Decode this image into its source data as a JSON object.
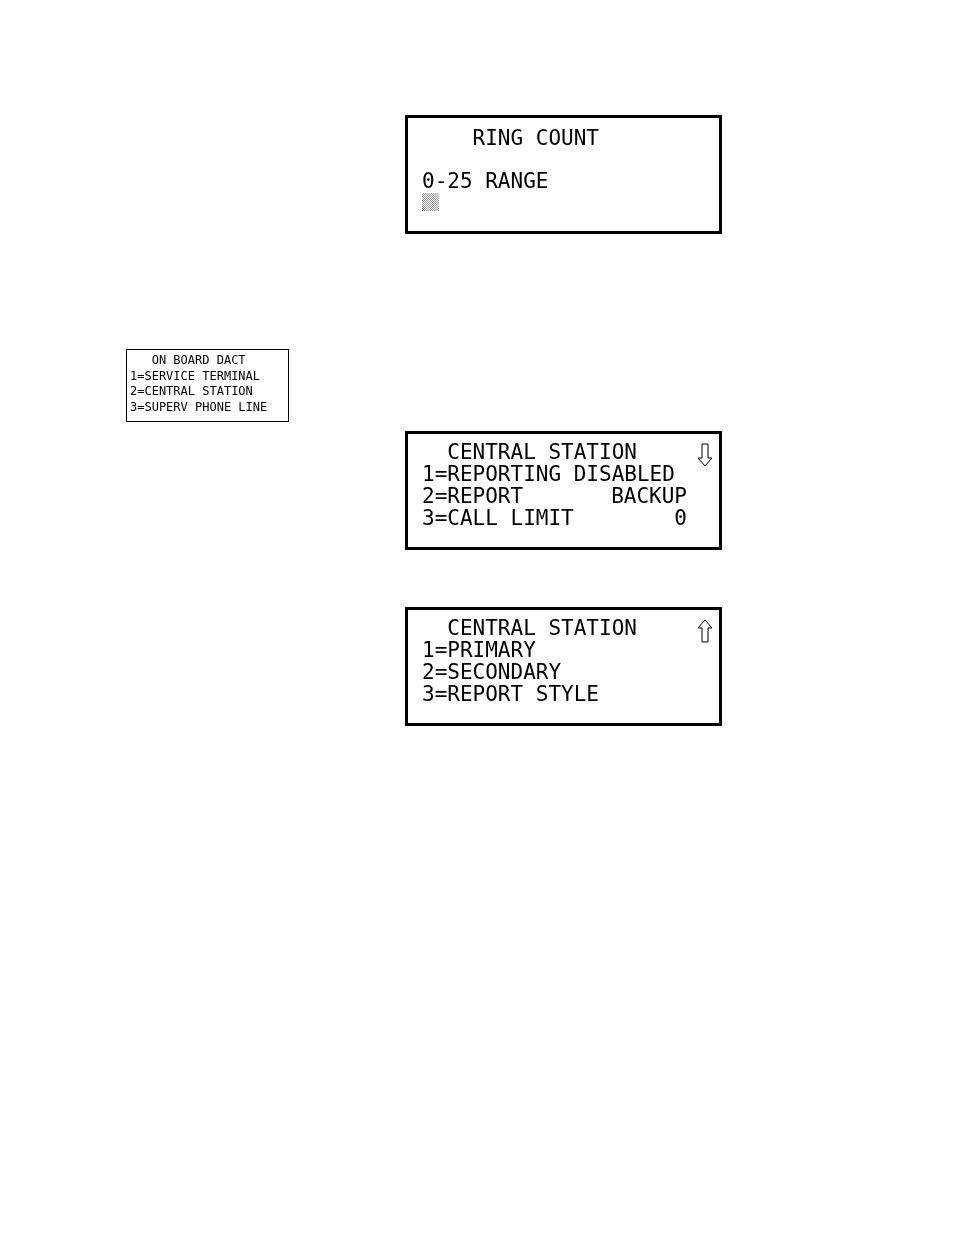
{
  "screens": [
    {
      "kind": "prompt",
      "title": "    RING COUNT",
      "lines": [
        {
          "kind": "text",
          "text": "0-25 RANGE"
        },
        {
          "kind": "entry",
          "cursor": true
        }
      ]
    },
    {
      "kind": "compact",
      "title": "   ON BOARD DACT",
      "lines": [
        {
          "kind": "text",
          "text": "1=SERVICE TERMINAL"
        },
        {
          "kind": "text",
          "text": "2=CENTRAL STATION"
        },
        {
          "kind": "text",
          "text": "3=SUPERV PHONE LINE"
        }
      ]
    },
    {
      "kind": "menu",
      "title": "  CENTRAL STATION",
      "more_below": true,
      "lines": [
        {
          "kind": "text",
          "text": "1=REPORTING DISABLED"
        },
        {
          "kind": "text",
          "text": "2=REPORT",
          "value": "BACKUP"
        },
        {
          "kind": "text",
          "text": "3=CALL LIMIT",
          "value": "0"
        }
      ]
    },
    {
      "kind": "menu",
      "title": "  CENTRAL STATION",
      "more_above": true,
      "lines": [
        {
          "kind": "text",
          "text": "1=PRIMARY"
        },
        {
          "kind": "text",
          "text": "2=SECONDARY"
        },
        {
          "kind": "text",
          "text": "3=REPORT STYLE"
        }
      ]
    }
  ]
}
